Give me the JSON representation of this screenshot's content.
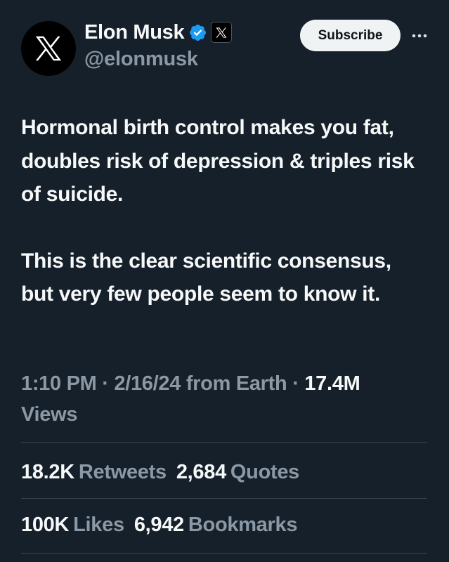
{
  "author": {
    "display_name": "Elon Musk",
    "handle": "@elonmusk",
    "verified_badge_color": "#1d9bf0",
    "avatar_icon": "x-logo-icon"
  },
  "header": {
    "subscribe_label": "Subscribe",
    "more_icon": "more-dots-icon"
  },
  "tweet": {
    "paragraphs": [
      "Hormonal birth control makes you fat, doubles risk of depression & triples risk of suicide.",
      "This is the clear scientific consensus, but very few people seem to know it."
    ]
  },
  "meta": {
    "time": "1:10 PM",
    "separator": " · ",
    "date": "2/16/24",
    "source": "from Earth",
    "views_count": "17.4M",
    "views_label": "Views"
  },
  "stats": {
    "retweets_count": "18.2K",
    "retweets_label": "Retweets",
    "quotes_count": "2,684",
    "quotes_label": "Quotes",
    "likes_count": "100K",
    "likes_label": "Likes",
    "bookmarks_count": "6,942",
    "bookmarks_label": "Bookmarks"
  },
  "colors": {
    "background": "#15202b",
    "text_primary": "#f7f9f9",
    "text_secondary": "#8b98a5",
    "divider": "#38444d"
  }
}
